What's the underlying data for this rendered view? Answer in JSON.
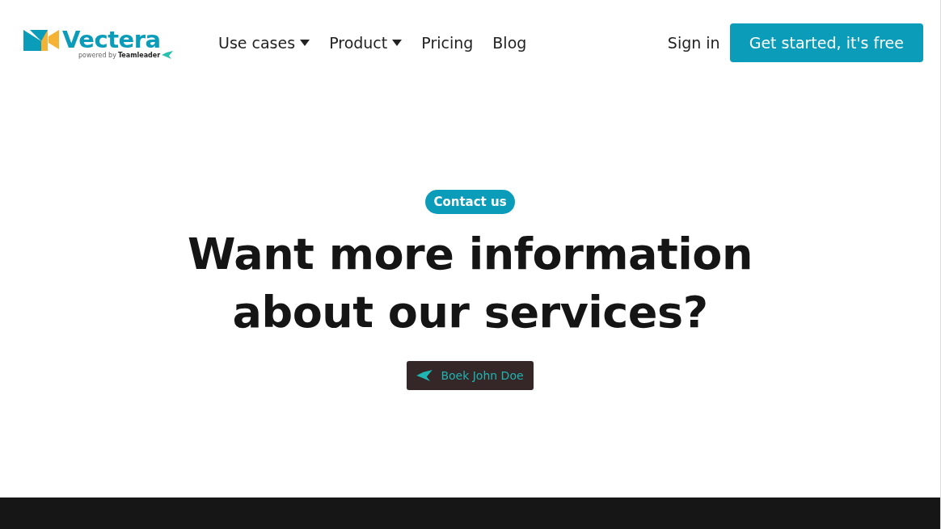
{
  "logo": {
    "name": "Vectera",
    "tagline": "powered by",
    "brand": "Teamleader"
  },
  "nav": [
    {
      "label": "Use cases",
      "kind": "dropdown"
    },
    {
      "label": "Product",
      "kind": "dropdown"
    },
    {
      "label": "Pricing",
      "kind": "link"
    },
    {
      "label": "Blog",
      "kind": "link"
    }
  ],
  "sign_in": "Sign in",
  "cta": "Get started, it's free",
  "hero": {
    "badge": "Contact us",
    "title": "Want more information about our services?",
    "book_button": "Boek John Doe"
  }
}
